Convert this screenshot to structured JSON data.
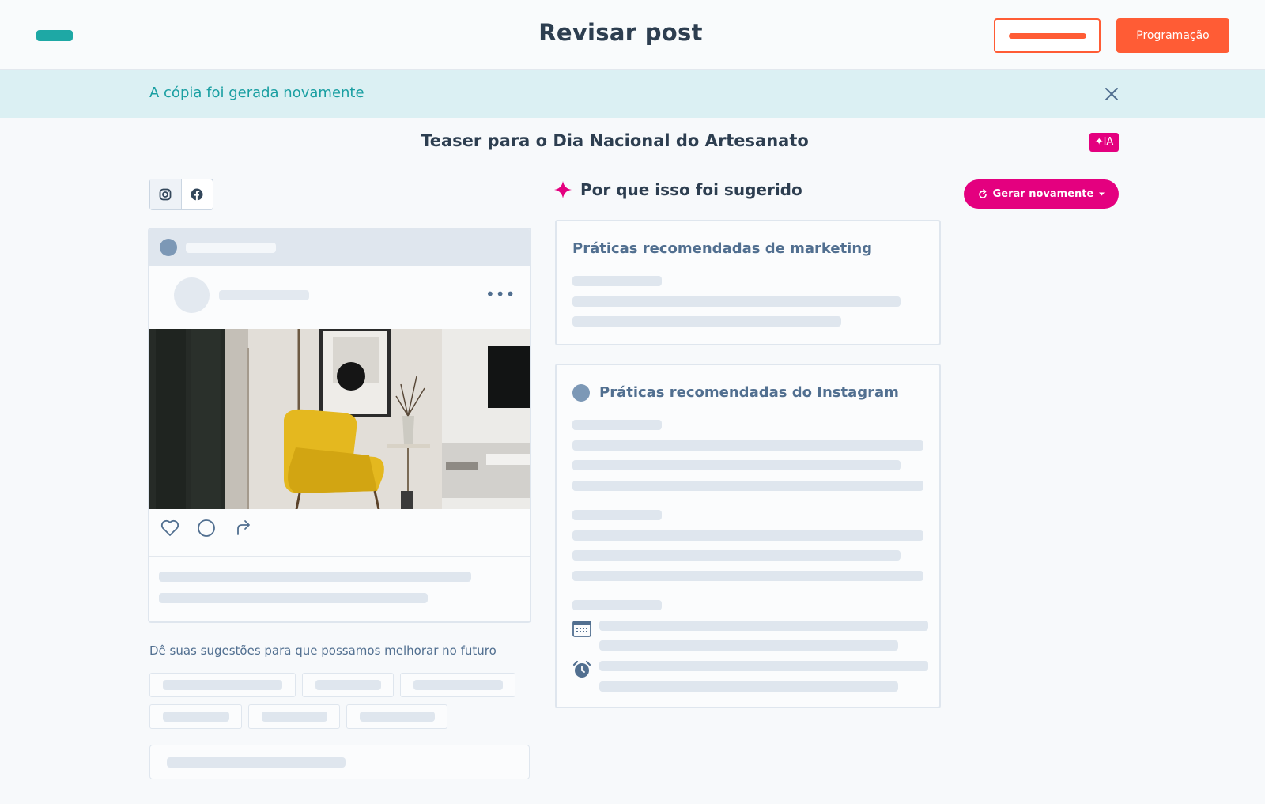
{
  "header": {
    "title": "Revisar post",
    "schedule_label": "Programação"
  },
  "banner": {
    "message": "A cópia foi gerada novamente"
  },
  "post": {
    "title": "Teaser para o Dia Nacional do Artesanato",
    "ai_badge": "✦IA"
  },
  "networks": {
    "items": [
      {
        "name": "instagram",
        "icon": "instagram-icon",
        "active": true
      },
      {
        "name": "facebook",
        "icon": "facebook-icon",
        "active": false
      }
    ]
  },
  "preview": {
    "more_icon": "•••",
    "actions": [
      "heart-icon",
      "comment-icon",
      "share-icon"
    ]
  },
  "feedback": {
    "label": "Dê suas sugestões para que possamos melhorar no futuro"
  },
  "suggestion": {
    "title": "Por que isso foi sugerido",
    "regenerate_label": "Gerar novamente",
    "cards": [
      {
        "title": "Práticas recomendadas de marketing"
      },
      {
        "title": "Práticas recomendadas do Instagram"
      }
    ]
  },
  "colors": {
    "accent": "#ff5c35",
    "ai": "#e4007f",
    "teal": "#1ea8a5",
    "banner_bg": "#dbf0f3"
  }
}
